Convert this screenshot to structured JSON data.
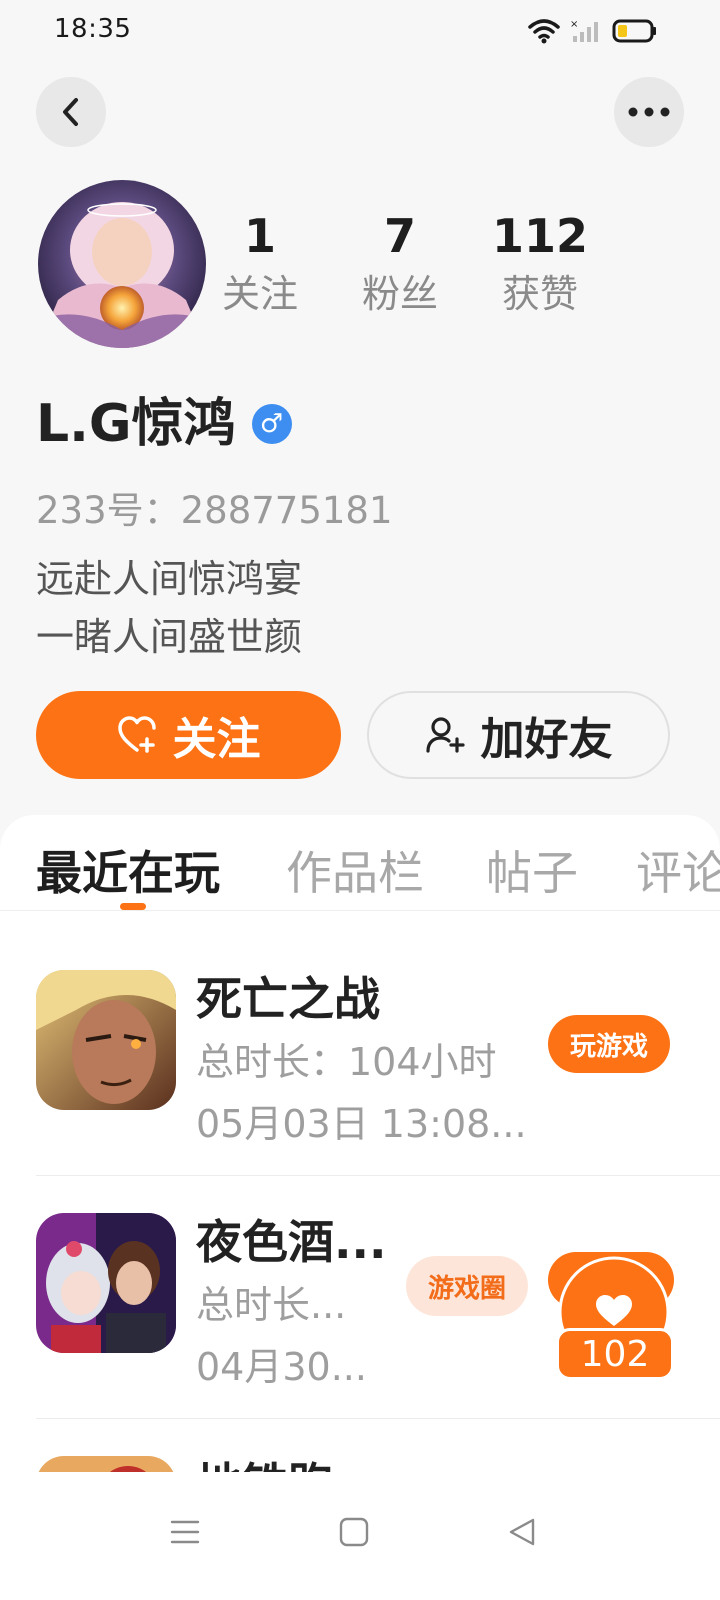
{
  "status_bar": {
    "time": "18:35",
    "icons": [
      "wifi-icon",
      "cellular-signal-icon",
      "battery-icon"
    ]
  },
  "header": {
    "back_icon": "chevron-left-icon",
    "more_icon": "more-dots-icon"
  },
  "profile": {
    "avatar_alt": "user avatar",
    "stats": [
      {
        "value": "1",
        "label": "关注"
      },
      {
        "value": "7",
        "label": "粉丝"
      },
      {
        "value": "112",
        "label": "获赞"
      }
    ],
    "username": "L.G惊鸿",
    "gender_symbol": "♂",
    "uid": "233号：288775181",
    "bio_line1": "远赴人间惊鸿宴",
    "bio_line2": "一睹人间盛世颜"
  },
  "actions": {
    "follow_label": "关注",
    "add_friend_label": "加好友"
  },
  "tabs": [
    {
      "label": "最近在玩",
      "active": true
    },
    {
      "label": "作品栏",
      "active": false
    },
    {
      "label": "帖子",
      "active": false
    },
    {
      "label": "评论",
      "active": false
    }
  ],
  "games": [
    {
      "title": "死亡之战",
      "duration": "总时长：104小时",
      "date": "05月03日 13:08...",
      "play_label": "玩游戏"
    },
    {
      "title": "夜色酒...",
      "duration": "总时长...",
      "date": "04月30...",
      "circle_label": "游戏圈"
    },
    {
      "title": "地铁跑"
    }
  ],
  "like_widget": {
    "count": "102"
  },
  "colors": {
    "accent": "#fd7214",
    "gender_badge": "#3d8ef0"
  }
}
